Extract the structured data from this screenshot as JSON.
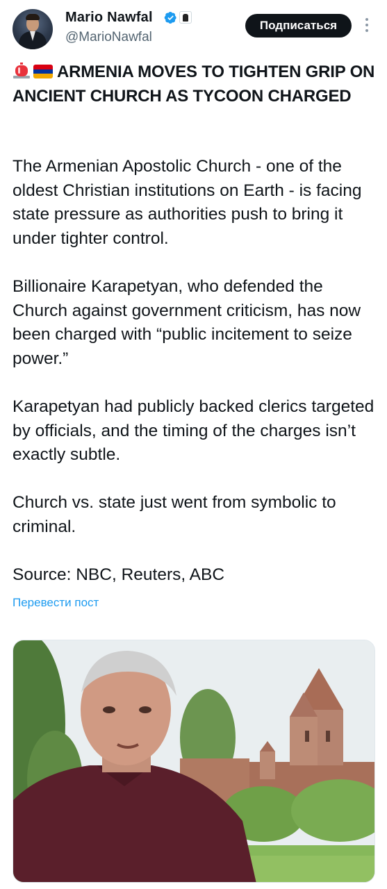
{
  "author": {
    "name": "Mario Nawfal",
    "handle": "@MarioNawfal",
    "subscribe_label": "Подписаться"
  },
  "tweet": {
    "headline": "ARMENIA MOVES TO TIGHTEN GRIP ON ANCIENT CHURCH AS TYCOON CHARGED",
    "paragraphs": [
      "The Armenian Apostolic Church - one of the oldest Christian institutions on Earth - is facing state pressure as authorities push to bring it under tighter control.",
      "Billionaire Karapetyan, who defended the Church against government criticism, has now been charged with “public incitement to seize power.”",
      "Karapetyan had publicly backed clerics targeted by officials, and the timing of the charges isn’t exactly subtle.",
      "Church vs. state just went from symbolic to criminal.",
      "Source: NBC, Reuters, ABC"
    ],
    "translate_label": "Перевести пост"
  },
  "icons": {
    "verified": "verified-badge-icon",
    "affiliate": "affiliate-badge-icon",
    "more": "more-options-icon",
    "siren": "rotating-light-emoji",
    "flag": "armenia-flag-emoji"
  },
  "colors": {
    "accent": "#1d9bf0",
    "button_bg": "#0f1419",
    "secondary_text": "#536471"
  }
}
